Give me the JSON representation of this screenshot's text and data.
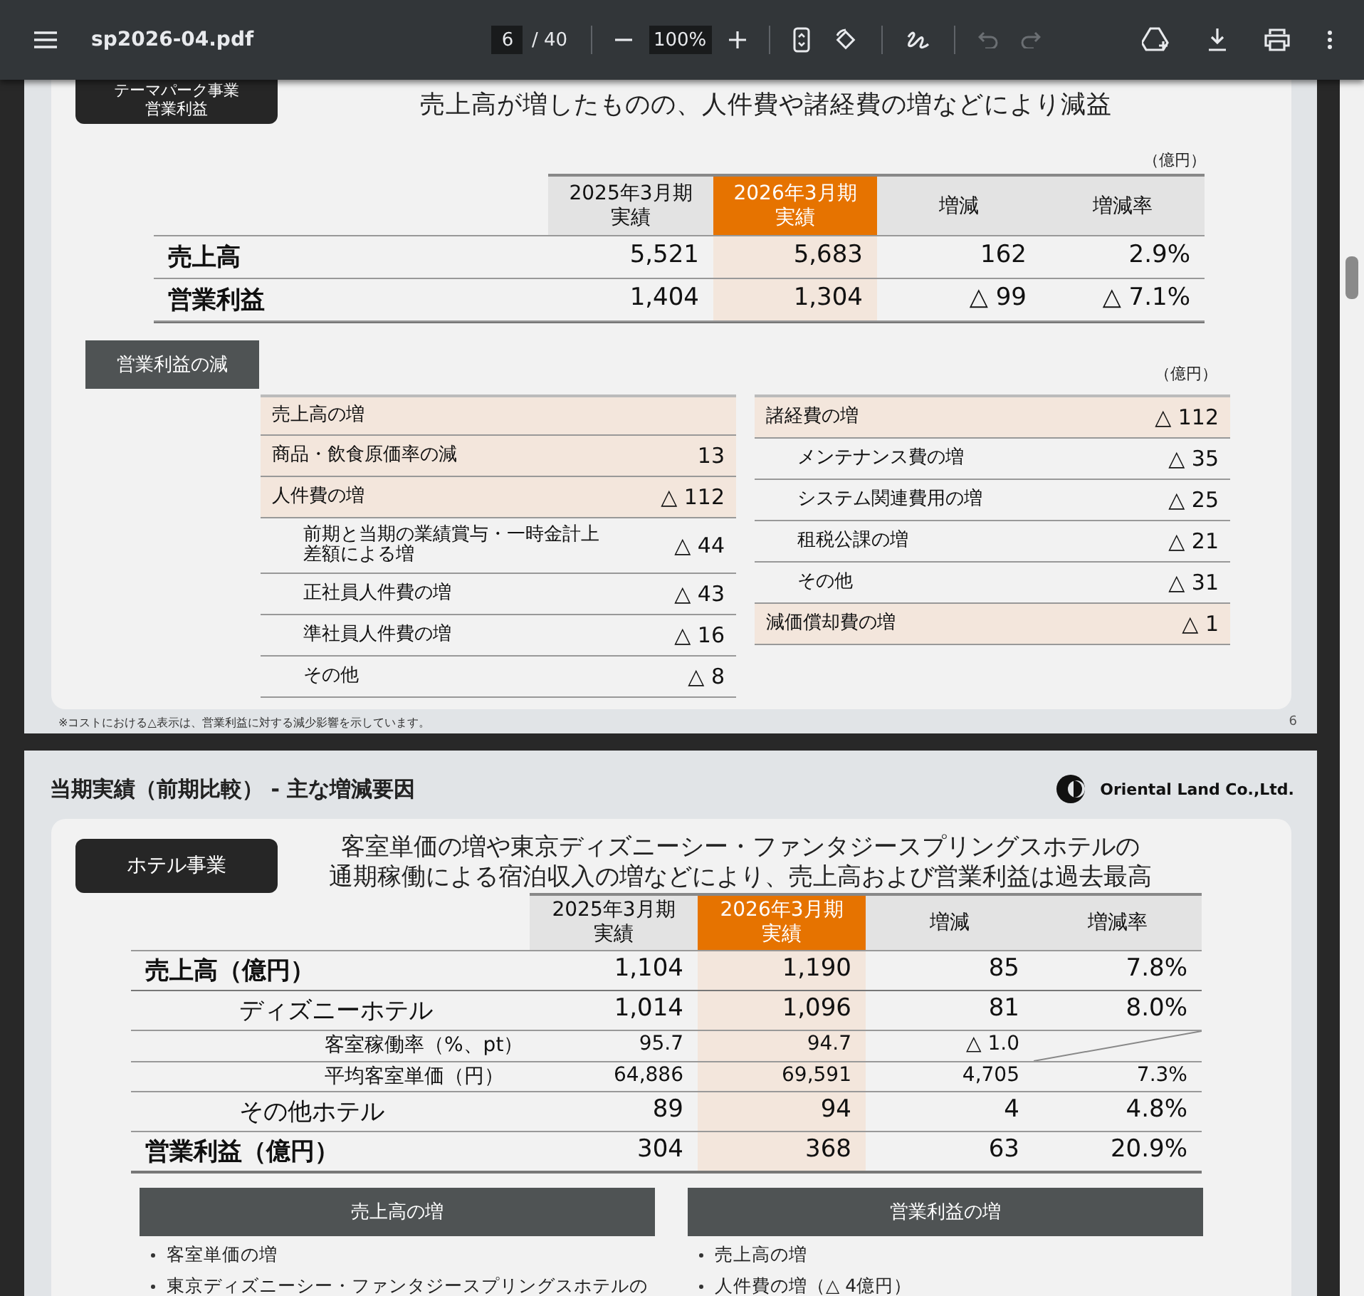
{
  "toolbar": {
    "filename": "sp2026-04.pdf",
    "page_current": "6",
    "page_total": "/ 40",
    "zoom": "100%",
    "history": [
      {
        "kind": "undo",
        "disabled": true
      },
      {
        "kind": "redo",
        "disabled": true
      }
    ]
  },
  "page_6": {
    "badge_lines": [
      "テーマパーク事業",
      "営業利益"
    ],
    "headline": "売上高が増したものの、人件費や諸経費の増などにより減益",
    "unit": "（億円）",
    "columns": [
      {
        "lines": [
          "2025年3月期",
          "実績"
        ],
        "current": false
      },
      {
        "lines": [
          "2026年3月期",
          "実績"
        ],
        "current": true
      },
      {
        "lines": [
          "増減"
        ],
        "current": false
      },
      {
        "lines": [
          "増減率"
        ],
        "current": false
      }
    ],
    "rows": [
      {
        "label": "売上高",
        "values": [
          "5,521",
          "5,683",
          "162",
          "2.9%"
        ]
      },
      {
        "label": "営業利益",
        "values": [
          "1,404",
          "1,304",
          "△ 99",
          "△ 7.1%"
        ]
      }
    ],
    "section_label": "営業利益の減",
    "section_unit": "（億円）",
    "left_list": [
      {
        "label": "売上高の増"
      },
      {
        "label": "商品・飲食原価率の減",
        "value": "13"
      },
      {
        "label": "人件費の増",
        "value": "△ 112",
        "children": [
          {
            "label": "前期と当期の業績賞与・一時金計上",
            "label_line_2": "差額による増",
            "value": "△ 44"
          },
          {
            "label": "正社員人件費の増",
            "value": "△ 43"
          },
          {
            "label": "準社員人件費の増",
            "value": "△ 16"
          },
          {
            "label": "その他",
            "value": "△ 8"
          }
        ]
      }
    ],
    "right_list": [
      {
        "label": "諸経費の増",
        "value": "△ 112",
        "children": [
          {
            "label": "メンテナンス費の増",
            "value": "△ 35"
          },
          {
            "label": "システム関連費用の増",
            "value": "△ 25"
          },
          {
            "label": "租税公課の増",
            "value": "△ 21"
          },
          {
            "label": "その他",
            "value": "△ 31"
          }
        ]
      },
      {
        "label": "減価償却費の増",
        "value": "△ 1"
      }
    ],
    "footnote": "※コストにおける△表示は、営業利益に対する減少影響を示しています。",
    "page_number": "6"
  },
  "page_7": {
    "title": "当期実績（前期比較） - 主な増減要因",
    "logo_text": "Oriental Land Co.,Ltd.",
    "badge": "ホテル事業",
    "headline": [
      "客室単価の増や東京ディズニーシー・ファンタジースプリングスホテルの",
      "通期稼働による宿泊収入の増などにより、売上高および営業利益は過去最高"
    ],
    "columns": [
      {
        "lines": [
          "2025年3月期",
          "実績"
        ],
        "current": false
      },
      {
        "lines": [
          "2026年3月期",
          "実績"
        ],
        "current": true
      },
      {
        "lines": [
          "増減"
        ],
        "current": false
      },
      {
        "lines": [
          "増減率"
        ],
        "current": false
      }
    ],
    "rows": [
      {
        "kind": "main",
        "label": "売上高（億円）",
        "values": [
          "1,104",
          "1,190",
          "85",
          "7.8%"
        ]
      },
      {
        "kind": "sub",
        "label": "ディズニーホテル",
        "values": [
          "1,014",
          "1,096",
          "81",
          "8.0%"
        ]
      },
      {
        "kind": "detail",
        "label": "客室稼働率（%、pt）",
        "values": [
          "95.7",
          "94.7",
          "△ 1.0"
        ]
      },
      {
        "kind": "detail",
        "label": "平均客室単価（円）",
        "values": [
          "64,886",
          "69,591",
          "4,705",
          "7.3%"
        ]
      },
      {
        "kind": "sub",
        "label": "その他ホテル",
        "values": [
          "89",
          "94",
          "4",
          "4.8%"
        ]
      },
      {
        "kind": "main",
        "label": "営業利益（億円）",
        "values": [
          "304",
          "368",
          "63",
          "20.9%"
        ]
      }
    ],
    "boxes": [
      {
        "title": "売上高の増",
        "bullets": [
          "客室単価の増",
          "東京ディズニーシー・ファンタジースプリングスホテルの"
        ]
      },
      {
        "title": "営業利益の増",
        "bullets": [
          "売上高の増",
          "人件費の増（△ 4億円）"
        ]
      }
    ]
  }
}
